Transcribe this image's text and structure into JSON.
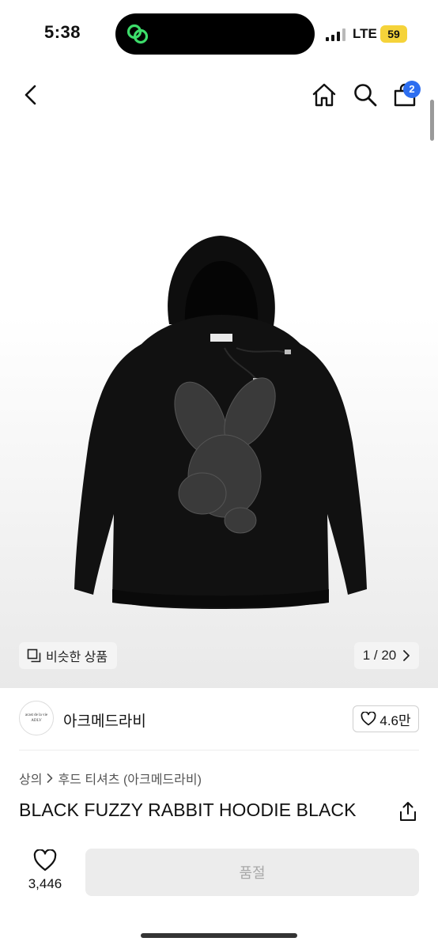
{
  "status_bar": {
    "time": "5:38",
    "network": "LTE",
    "battery": "59"
  },
  "nav": {
    "cart_count": "2"
  },
  "gallery": {
    "similar_label": "비슷한 상품",
    "pager": "1 / 20"
  },
  "brand": {
    "logo_text_1": "acast de la vie",
    "logo_text_2": "ADLV",
    "name": "아크메드라비",
    "likes": "4.6만"
  },
  "breadcrumb": {
    "category": "상의",
    "subcategory": "후드 티셔츠 (아크메드라비)"
  },
  "product": {
    "title": "BLACK FUZZY RABBIT HOODIE BLACK"
  },
  "bottom_bar": {
    "wish_count": "3,446",
    "action_label": "품절"
  },
  "colors": {
    "badge": "#2d6ef0",
    "battery": "#f5d33a",
    "disabled_button": "#ececec"
  }
}
